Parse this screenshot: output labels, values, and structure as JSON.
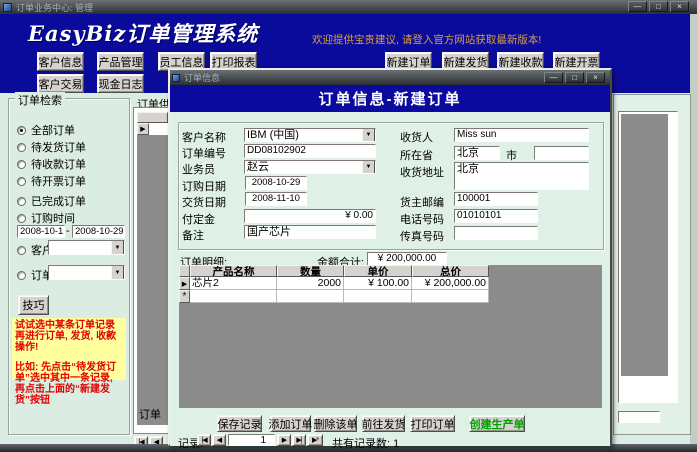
{
  "window": {
    "title": "订单业务中心: 管理",
    "controls": {
      "minimize": "—",
      "maximize": "□",
      "close": "×"
    },
    "brand": "EasyBiz订单管理系统",
    "welcome": "欢迎提供宝贵建议, 请登入官方网站获取最新版本!",
    "toolbar": {
      "row1_left": [
        "客户信息",
        "产品管理",
        "员工信息",
        "打印报表"
      ],
      "row1_right": [
        "新建订单",
        "新建发货",
        "新建收款",
        "新建开票"
      ],
      "row2_left": [
        "客户交易",
        "现金日志"
      ]
    }
  },
  "sidebar": {
    "title": "订单检索",
    "radios": [
      "全部订单",
      "待发货订单",
      "待收款订单",
      "待开票订单",
      "已完成订单",
      "订购时间"
    ],
    "selected_radio": "全部订单",
    "date_from": "2008-10-1",
    "date_sep": "-",
    "date_to": "2008-10-29",
    "customer_label": "客户",
    "order_label": "订单",
    "tips_button": "技巧",
    "tip1": "试试选中某条订单记录 再进行订单, 发货, 收款操作!",
    "tip2": "比如: 先点击“待发货订单”选中其中一条记录, 再点击上面的“新建发货”按钮"
  },
  "background": {
    "list_label": "订单供",
    "bottom_fragment": "订单",
    "nav_first": "|◀",
    "nav_prev": "◀"
  },
  "icons": {
    "dropdown": "▼",
    "row_selector": "▶",
    "new_row": "*"
  },
  "dialog": {
    "title": "订单信息",
    "controls": {
      "minimize": "—",
      "maximize": "□",
      "close": "×"
    },
    "header": "订单信息-新建订单",
    "form": {
      "customer_label": "客户名称",
      "customer_value": "IBM (中国)",
      "order_no_label": "订单编号",
      "order_no_value": "DD08102902",
      "salesman_label": "业务员",
      "salesman_value": "赵云",
      "order_date_label": "订购日期",
      "order_date_value": "2008-10-29",
      "delivery_date_label": "交货日期",
      "delivery_date_value": "2008-11-10",
      "deposit_label": "付定金",
      "deposit_value": "¥ 0.00",
      "remark_label": "备注",
      "remark_value": "国产芯片",
      "consignee_label": "收货人",
      "consignee_value": "Miss sun",
      "province_label": "所在省",
      "province_value": "北京",
      "city_label": "市",
      "city_value": "",
      "address_label": "收货地址",
      "address_value": "北京",
      "zip_label": "货主邮编",
      "zip_value": "100001",
      "phone_label": "电话号码",
      "phone_value": "01010101",
      "fax_label": "传真号码",
      "fax_value": ""
    },
    "detail": {
      "label": "订单明细:",
      "total_label": "金额合计:",
      "total_value": "¥ 200,000.00",
      "columns": [
        "产品名称",
        "数量",
        "单价",
        "总价"
      ],
      "row": [
        "芯片2",
        "2000",
        "¥ 100.00",
        "¥ 200,000.00"
      ]
    },
    "buttons": [
      "保存记录",
      "添加订单",
      "删除该单",
      "前往发货",
      "打印订单",
      "创建生产单"
    ],
    "nav": {
      "label": "记录:",
      "first": "|◀",
      "prev": "◀",
      "value": "1",
      "next": "▶",
      "last": "▶|",
      "new": "▶*",
      "count": "共有记录数: 1"
    }
  },
  "colors": {
    "header_blue": "#0B0B9B",
    "dialog_header_blue": "#0A0A9E",
    "welcome_orange": "#D79F44",
    "content_mint": "#DBEDE2",
    "tip_yellow": "#FFFF9E",
    "tip_red": "#E10000",
    "grid_gray": "#8C8C8C",
    "green_button_text": "#00A000"
  }
}
